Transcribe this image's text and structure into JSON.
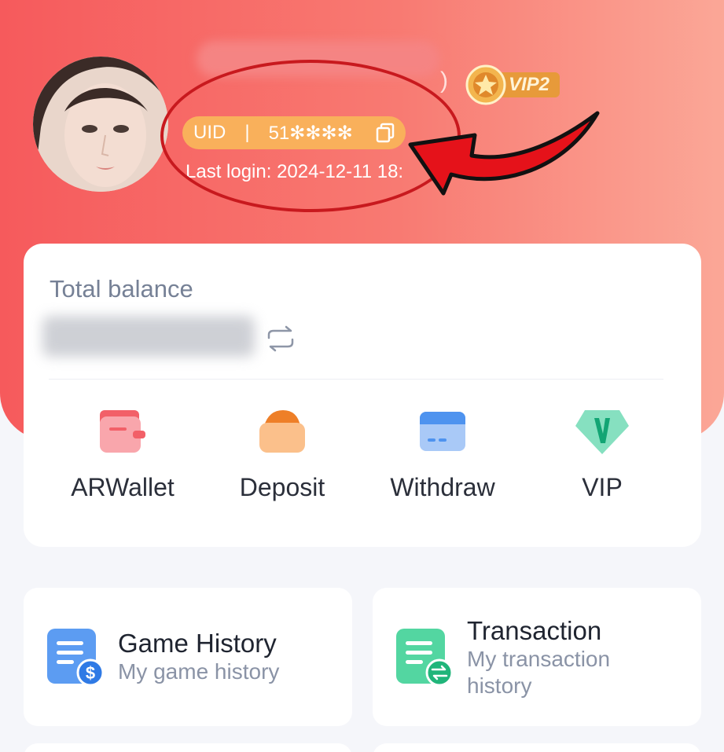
{
  "profile": {
    "vip_level": "VIP2",
    "uid_label": "UID",
    "uid_separator": "|",
    "uid_value": "51✻✻✻✻",
    "last_login": "Last login: 2024-12-11 18:",
    "name_paren": ")"
  },
  "balance": {
    "title": "Total balance"
  },
  "actions": [
    {
      "label": "ARWallet",
      "icon": "wallet-icon"
    },
    {
      "label": "Deposit",
      "icon": "deposit-icon"
    },
    {
      "label": "Withdraw",
      "icon": "withdraw-card-icon"
    },
    {
      "label": "VIP",
      "icon": "vip-icon"
    }
  ],
  "menu": [
    {
      "title": "Game History",
      "subtitle": "My game history",
      "icon": "game-history-icon"
    },
    {
      "title": "Transaction",
      "subtitle": "My transaction history",
      "icon": "transaction-icon"
    }
  ],
  "colors": {
    "header_left": "#f65a5c",
    "header_right": "#fba797",
    "uid_pill": "#f9b05b",
    "annotation": "#c8191e"
  }
}
